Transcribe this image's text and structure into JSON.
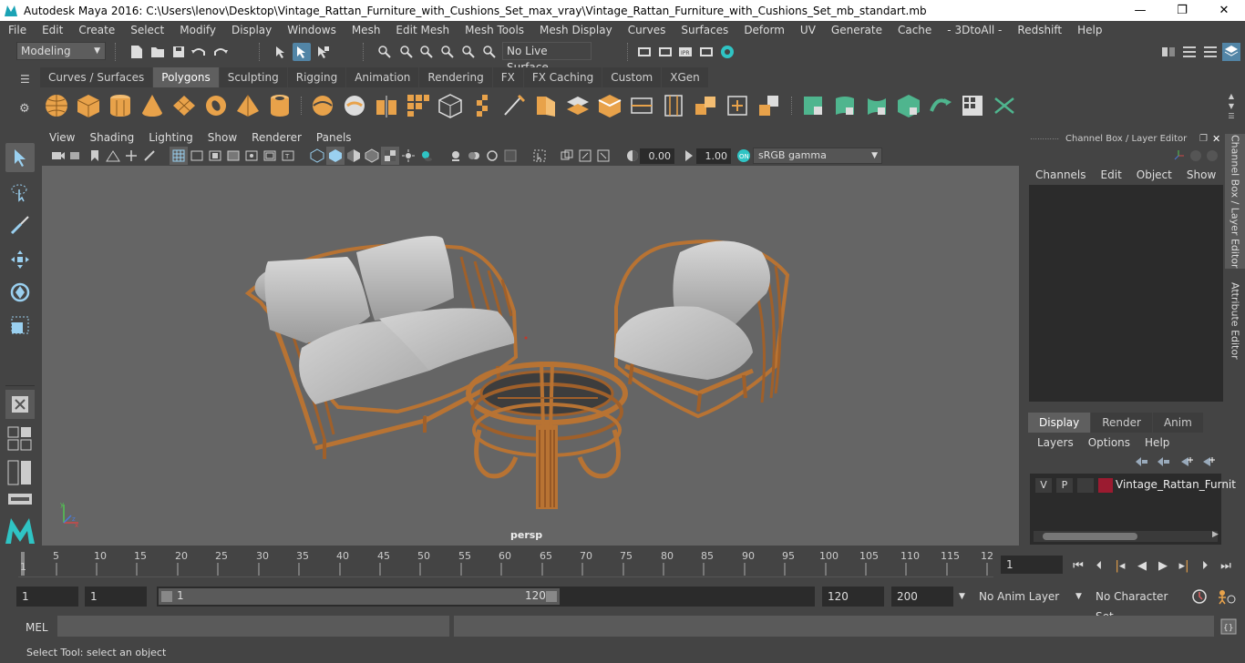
{
  "window": {
    "title": "Autodesk Maya 2016: C:\\Users\\lenov\\Desktop\\Vintage_Rattan_Furniture_with_Cushions_Set_max_vray\\Vintage_Rattan_Furniture_with_Cushions_Set_mb_standart.mb",
    "minimize": "—",
    "restore": "❐",
    "close": "✕"
  },
  "menubar": {
    "items": [
      "File",
      "Edit",
      "Create",
      "Select",
      "Modify",
      "Display",
      "Windows",
      "Mesh",
      "Edit Mesh",
      "Mesh Tools",
      "Mesh Display",
      "Curves",
      "Surfaces",
      "Deform",
      "UV",
      "Generate",
      "Cache",
      "- 3DtoAll -",
      "Redshift",
      "Help"
    ]
  },
  "statusline": {
    "mode": "Modeling",
    "live_surface": "No Live Surface"
  },
  "shelf": {
    "tabs": [
      "Curves / Surfaces",
      "Polygons",
      "Sculpting",
      "Rigging",
      "Animation",
      "Rendering",
      "FX",
      "FX Caching",
      "Custom",
      "XGen"
    ],
    "active_tab": "Polygons"
  },
  "viewport": {
    "menu": [
      "View",
      "Shading",
      "Lighting",
      "Show",
      "Renderer",
      "Panels"
    ],
    "field_a": "0.00",
    "field_b": "1.00",
    "color_space": "sRGB gamma",
    "camera_label": "persp"
  },
  "channel_box": {
    "title": "Channel Box / Layer Editor",
    "menu": [
      "Channels",
      "Edit",
      "Object",
      "Show"
    ],
    "side_tab_1": "Channel Box / Layer Editor",
    "side_tab_2": "Attribute Editor"
  },
  "layer_editor": {
    "tabs": [
      "Display",
      "Render",
      "Anim"
    ],
    "active_tab": "Display",
    "menu": [
      "Layers",
      "Options",
      "Help"
    ],
    "layer": {
      "v": "V",
      "p": "P",
      "name": "Vintage_Rattan_Furnit",
      "color": "#9b1b30"
    }
  },
  "timeline": {
    "ticks": [
      "5",
      "10",
      "15",
      "20",
      "25",
      "30",
      "35",
      "40",
      "45",
      "50",
      "55",
      "60",
      "65",
      "70",
      "75",
      "80",
      "85",
      "90",
      "95",
      "100",
      "105",
      "110",
      "115",
      "12"
    ],
    "start_marker": "1",
    "current_frame": "1"
  },
  "range": {
    "start": "1",
    "anim_start": "1",
    "slider_start": "1",
    "slider_end": "120",
    "end": "120",
    "anim_end": "200",
    "anim_layer": "No Anim Layer",
    "char_set": "No Character Set"
  },
  "command": {
    "label": "MEL",
    "help": "Select Tool: select an object"
  },
  "colors": {
    "shelf_orange": "#e8a24a",
    "shelf_green": "#4fb58e",
    "maya_teal": "#2fc4c4"
  }
}
